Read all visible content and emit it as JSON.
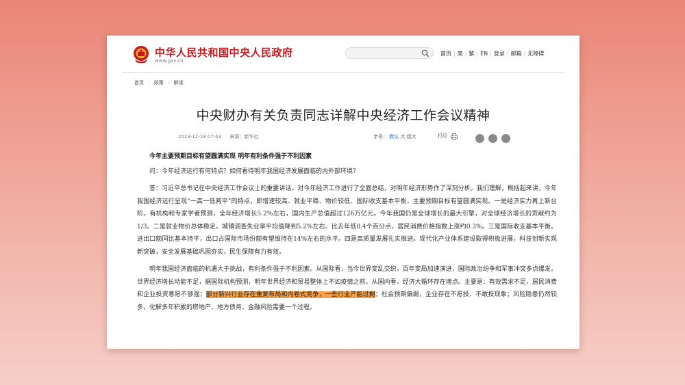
{
  "header": {
    "site_title": "中华人民共和国中央人民政府",
    "site_url": "www.gov.cn",
    "nav_links": [
      "首页",
      "简",
      "繁",
      "EN",
      "登录",
      "邮箱",
      "无障碍"
    ],
    "search": {
      "placeholder": ""
    }
  },
  "breadcrumb": [
    "首页",
    "政策",
    "解读"
  ],
  "article": {
    "title": "中央财办有关负责同志详解中央经济工作会议精神",
    "date": "2023-12-18 07:43",
    "source_label": "来源：",
    "source": "新华社",
    "font_size_label": "字号：",
    "font_sizes": [
      "默认",
      "大",
      "超大"
    ],
    "active_font_size": "默认",
    "print_label": "打印",
    "share_icons": [
      "wechat-icon",
      "weibo-icon",
      "qzone-icon"
    ],
    "subheading": "今年主要预期目标有望圆满实现 明年有利条件强于不利因素",
    "question": "问：今年经济运行有何特点？如何看待明年我国经济发展面临的内外部环境？",
    "answer_p1": "答：习近平总书记在中央经济工作会议上的重要讲话，对今年经济工作进行了全面总结，对明年经济形势作了深刻分析。我们理解，概括起来讲，今年我国经济运行呈现“一高一低两平”的特点，即增速较高、就业平稳、物价较低、国际收支基本平衡，主要预期目标有望圆满实现。一是经济实力再上新台阶。有机构和专家学者预测，全年经济增长5.2%左右，国内生产总值超过126万亿元。今年我国仍是全球增长的最大引擎，对全球经济增长的贡献约为1/3。二是就业物价总体稳定。城镇调查失业率平均值降到5.2%左右、比去年低0.4个百分点，居民消费价格指数上涨约0.3%。三是国际收支基本平衡。进出口额同比基本持平，出口占国际市场份额有望维持在14%左右的水平。四是高质量发展扎实推进。现代化产业体系建设取得积极进展，科技创新实现新突破，安全发展基础巩固夯实，民生保障有力有效。",
    "answer_p2_before": "明年我国经济面临的机遇大于挑战，有利条件强于不利因素。从国际看，当今世界变乱交织，百年变局加速演进，国际政治纷争和军事冲突多点爆发。世界经济增长动能不足，据国际机构预测，明年世界经济和贸易整体上不如疫情之前。从国内看，经济大循环存在堵点。主要是：有效需求不足，居民消费和企业投资意愿不够强；",
    "answer_p2_highlight": "部分新兴行业存在重复布局和内卷式竞争，一些行业产能过剩",
    "answer_p2_after": "；社会预期偏弱，企业存在不愿投、不敢投现象；风险隐患仍然较多，化解多年积累的房地产、地方债务、金融风险需要一个过程。",
    "highlight_color": "#f2a14a"
  }
}
